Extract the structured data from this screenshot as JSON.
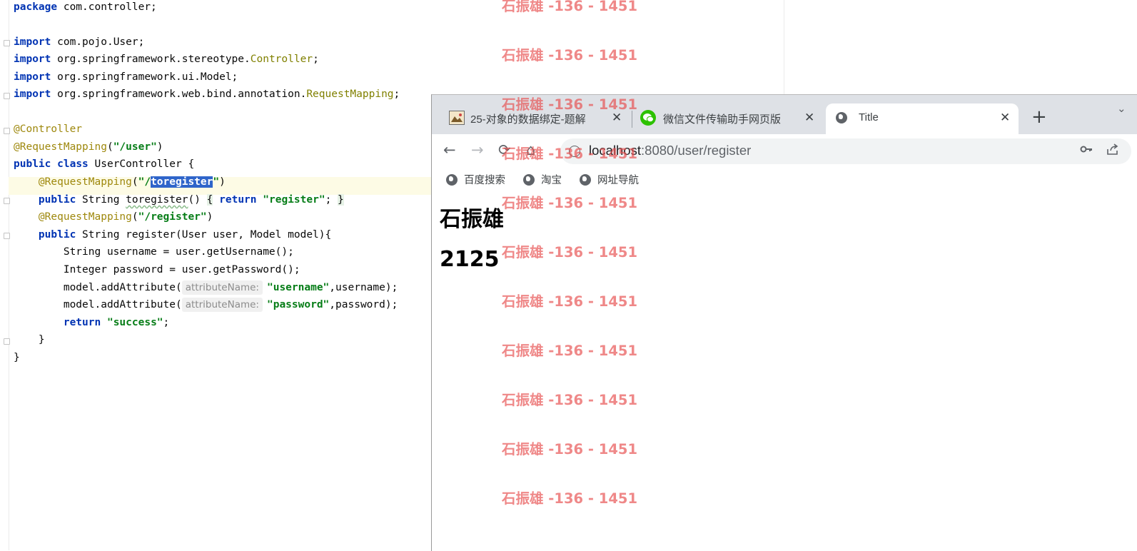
{
  "editor": {
    "lines": {
      "l1": {
        "kw": "package",
        "rest": " com.controller;"
      },
      "l3": {
        "kw": "import",
        "rest": " com.pojo.User;"
      },
      "l4": {
        "kw": "import",
        "rest": " org.springframework.stereotype.",
        "cls": "Controller",
        "end": ";"
      },
      "l5": {
        "kw": "import",
        "rest": " org.springframework.ui.Model;"
      },
      "l6": {
        "kw": "import",
        "rest": " org.springframework.web.bind.annotation.",
        "cls": "RequestMapping",
        "end": ";"
      },
      "l8": {
        "ann": "@Controller"
      },
      "l9": {
        "ann": "@RequestMapping",
        "open": "(",
        "str": "\"/user\"",
        "close": ")"
      },
      "l10": {
        "kw1": "public",
        "kw2": "class",
        "rest": " UserController {"
      },
      "l11": {
        "ann": "@RequestMapping",
        "open": "(",
        "str_a": "\"/",
        "sel": "toregister",
        "str_b": "\"",
        "close": ")"
      },
      "l12": {
        "kw": "public",
        "rest": " String ",
        "method": "toregister",
        "rest2": "() ",
        "brace": "{",
        "kw_ret": "return",
        "str": "\"register\"",
        "semi": "; ",
        "brace2": "}"
      },
      "l13": {
        "ann": "@RequestMapping",
        "open": "(",
        "str": "\"/register\"",
        "close": ")"
      },
      "l14": {
        "kw": "public",
        "rest": " String register(User user, Model model){"
      },
      "l15": {
        "rest": "String username = user.getUsername();"
      },
      "l16": {
        "rest": "Integer password = user.getPassword();"
      },
      "l17": {
        "pre": "model.addAttribute(",
        "hint": "attributeName:",
        "str": "\"username\"",
        "post": ",username);"
      },
      "l18": {
        "pre": "model.addAttribute(",
        "hint": "attributeName:",
        "str": "\"password\"",
        "post": ",password);"
      },
      "l19": {
        "kw": "return",
        "str": "\"success\"",
        "semi": ";"
      },
      "l20": {
        "rest": "}"
      },
      "l21": {
        "rest": "}"
      }
    }
  },
  "browser": {
    "tabs": [
      {
        "title": "25-对象的数据绑定-题解",
        "close": "✕",
        "icon": "image-favicon-icon"
      },
      {
        "title": "微信文件传输助手网页版",
        "close": "✕",
        "icon": "wechat-icon"
      },
      {
        "title": "Title",
        "close": "✕",
        "icon": "globe-icon"
      }
    ],
    "new_tab": "+",
    "tab_menu": "⌄",
    "nav": {
      "back": "←",
      "forward": "→",
      "reload": "⟳",
      "home": "⌂"
    },
    "address": {
      "host": "localhost",
      "rest": ":8080/user/register"
    },
    "bookmarks": [
      "百度搜索",
      "淘宝",
      "网址导航"
    ],
    "page": {
      "heading1": "石振雄",
      "heading2": "2125"
    },
    "colors": {
      "tabstrip": "#dee1e6",
      "omnibox": "#f1f3f4"
    }
  },
  "watermark": {
    "text": "石振雄 -136 - 1451",
    "color": "#e85050"
  }
}
